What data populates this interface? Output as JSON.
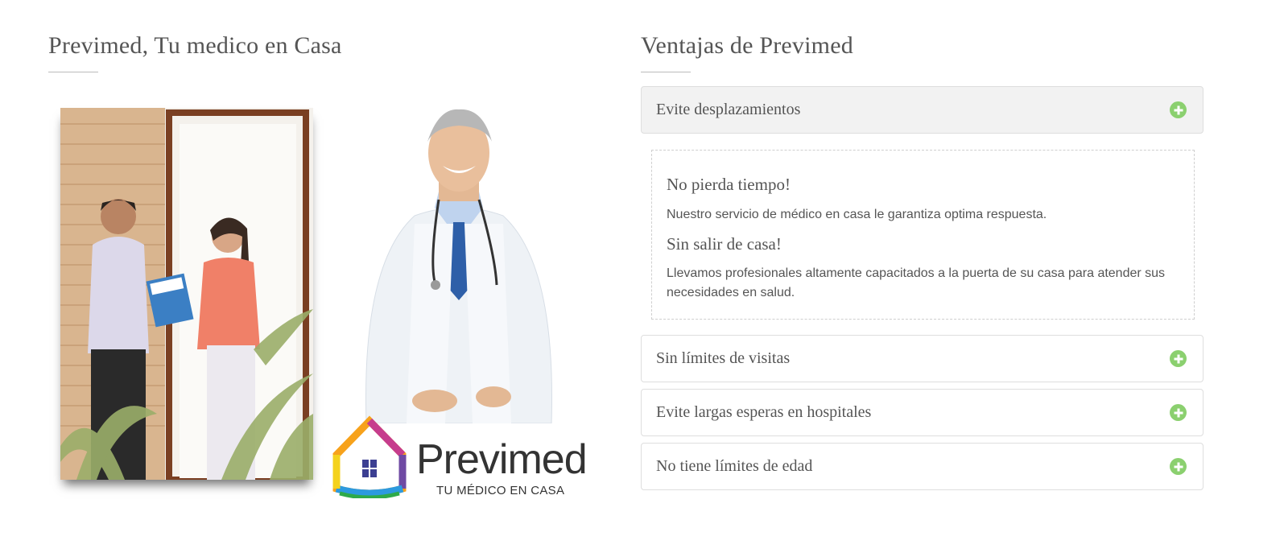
{
  "left": {
    "title": "Previmed, Tu medico en Casa",
    "logo": {
      "word": "Previmed",
      "tagline": "TU MÉDICO EN CASA"
    }
  },
  "right": {
    "title": "Ventajas de Previmed",
    "accordion": [
      {
        "label": "Evite desplazamientos",
        "expanded": true,
        "icon": "plus-circle-icon"
      },
      {
        "label": "Sin límites de visitas",
        "expanded": false,
        "icon": "plus-circle-icon"
      },
      {
        "label": "Evite largas esperas en hospitales",
        "expanded": false,
        "icon": "plus-circle-icon"
      },
      {
        "label": "No tiene límites de edad",
        "expanded": false,
        "icon": "plus-circle-icon"
      }
    ],
    "panel": {
      "heading1": "No pierda tiempo!",
      "text1": "Nuestro servicio de médico en casa le garantiza optima respuesta.",
      "heading2": "Sin salir de casa!",
      "text2": "Llevamos profesionales altamente capacitados a la puerta de su casa para atender sus necesidades en salud."
    }
  },
  "colors": {
    "accent_green": "#8bd06f",
    "text": "#555555",
    "open_header_bg": "#f2f2f2",
    "border": "#dedede"
  }
}
